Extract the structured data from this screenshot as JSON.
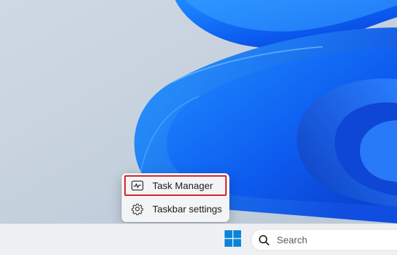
{
  "context_menu": {
    "items": [
      {
        "label": "Task Manager",
        "icon": "task-manager-icon",
        "highlighted": true
      },
      {
        "label": "Taskbar settings",
        "icon": "gear-icon"
      }
    ],
    "highlight_color": "#d61a1a"
  },
  "taskbar": {
    "start_icon": "windows-start-icon",
    "start_color": "#0a84d8",
    "search": {
      "placeholder": "Search",
      "value": "",
      "icon": "search-icon"
    }
  },
  "wallpaper": {
    "name": "Windows 11 Bloom",
    "accent": "#1e6dff",
    "background": "#c9d5e1"
  }
}
